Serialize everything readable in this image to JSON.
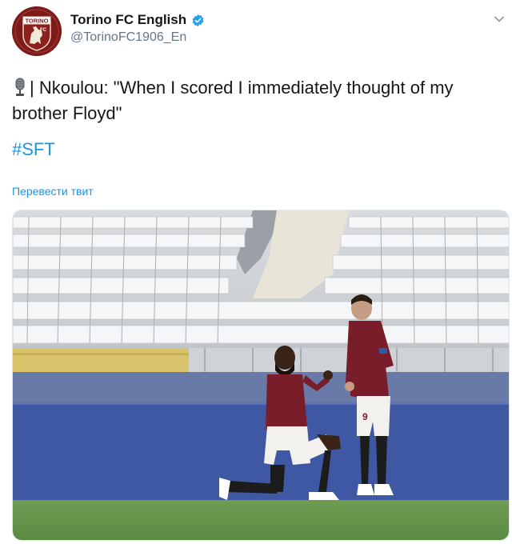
{
  "account": {
    "display_name": "Torino FC English",
    "handle": "@TorinoFC1906_En",
    "verified": true,
    "avatar_badge_text": "TORINO",
    "avatar_badge_sub": "FC"
  },
  "tweet": {
    "icon": "studio-microphone-icon",
    "text_prefix": "| Nkoulou: \"When I scored I immediately thought of my brother Floyd\"",
    "hashtag": "#SFT",
    "translate_link": "Перевести твит"
  },
  "media": {
    "description_icon": "photo",
    "player_numbers": [
      "9"
    ]
  },
  "colors": {
    "link": "#1b95e0",
    "verified": "#1da1f2",
    "brand": "#8a1c1c",
    "handle": "#657786"
  }
}
